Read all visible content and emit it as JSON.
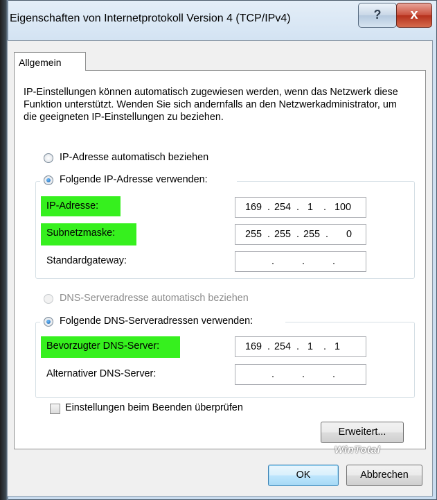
{
  "window": {
    "title": "Eigenschaften von Internetprotokoll Version 4 (TCP/IPv4)",
    "help_glyph": "?",
    "close_glyph": "x"
  },
  "tabs": [
    {
      "label": "Allgemein",
      "selected": true
    }
  ],
  "general": {
    "description": "IP-Einstellungen können automatisch zugewiesen werden, wenn das Netzwerk diese Funktion unterstützt. Wenden Sie sich andernfalls an den Netzwerkadministrator, um die geeigneten IP-Einstellungen zu beziehen.",
    "ip_auto_label": "IP-Adresse automatisch beziehen",
    "ip_manual_label": "Folgende IP-Adresse verwenden:",
    "ip_mode": "manual",
    "ip_fields": [
      {
        "label": "IP-Adresse:",
        "octets": [
          "169",
          "254",
          "1",
          "100"
        ],
        "highlighted": true
      },
      {
        "label": "Subnetzmaske:",
        "octets": [
          "255",
          "255",
          "255",
          "0"
        ],
        "highlighted": true
      },
      {
        "label": "Standardgateway:",
        "octets": [
          "",
          "",
          "",
          ""
        ],
        "highlighted": false
      }
    ],
    "dns_auto_label": "DNS-Serveradresse automatisch beziehen",
    "dns_manual_label": "Folgende DNS-Serveradressen verwenden:",
    "dns_mode": "manual",
    "dns_fields": [
      {
        "label": "Bevorzugter DNS-Server:",
        "octets": [
          "169",
          "254",
          "1",
          "1"
        ],
        "highlighted": true
      },
      {
        "label": "Alternativer DNS-Server:",
        "octets": [
          "",
          "",
          "",
          ""
        ],
        "highlighted": false
      }
    ],
    "validate_label": "Einstellungen beim Beenden überprüfen",
    "validate_checked": false,
    "advanced_label": "Erweitert..."
  },
  "footer": {
    "ok_label": "OK",
    "cancel_label": "Abbrechen"
  },
  "watermark": "WinTotal",
  "colors": {
    "highlight": "#36f01e",
    "close_button": "#c9503c"
  }
}
